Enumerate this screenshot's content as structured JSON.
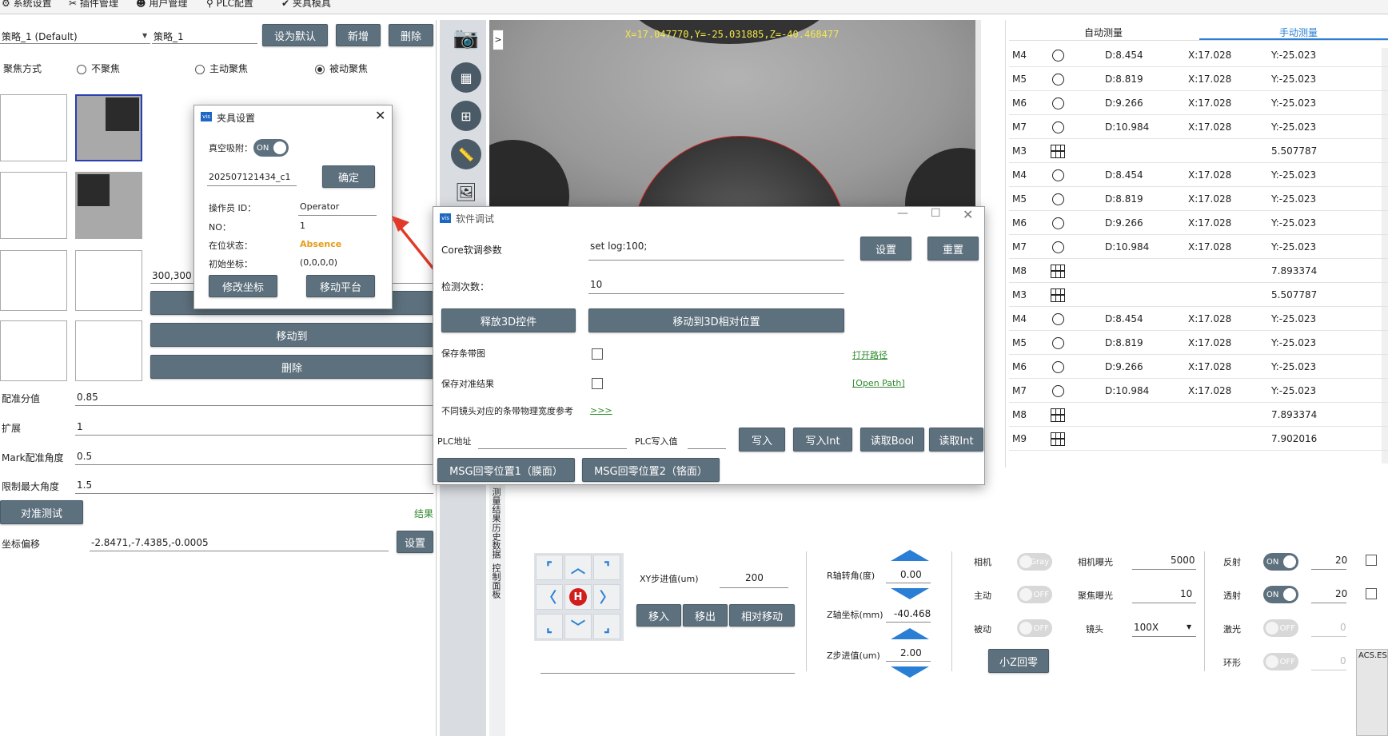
{
  "menu": [
    "系统设置",
    "插件管理",
    "用户管理",
    "PLC配置",
    "夹具模具"
  ],
  "left": {
    "strategy_select": "策略_1 (Default)",
    "strategy_name": "策略_1",
    "btn_set_default": "设为默认",
    "btn_add": "新增",
    "btn_delete": "删除",
    "focus_label": "聚焦方式",
    "focus_opts": [
      "不聚焦",
      "主动聚焦",
      "被动聚焦"
    ],
    "coord_field": "300,300",
    "btn_move_to": "移动到",
    "btn_delete2": "删除",
    "fields": [
      {
        "label": "配准分值",
        "value": "0.85"
      },
      {
        "label": "扩展",
        "value": "1"
      },
      {
        "label": "Mark配准角度",
        "value": "0.5"
      },
      {
        "label": "限制最大角度",
        "value": "1.5"
      }
    ],
    "btn_align_test": "对准测试",
    "result_label": "结果",
    "offset_label": "坐标偏移",
    "offset_value": "-2.8471,-7.4385,-0.0005",
    "btn_offset_set": "设置"
  },
  "camera": {
    "coords": "X=17.047770,Y=-25.031885,Z=-40.468477",
    "expand_btn": ">"
  },
  "fixture_dialog": {
    "title": "夹具设置",
    "vacuum_label": "真空吸附：",
    "vacuum_state": "ON",
    "code": "202507121434_c1",
    "btn_confirm": "确定",
    "operator_label": "操作员 ID：",
    "operator": "Operator",
    "no_label": "NO：",
    "no": "1",
    "status_label": "在位状态：",
    "status": "Absence",
    "init_label": "初始坐标：",
    "init": "(0,0,0,0)",
    "btn_modify": "修改坐标",
    "btn_move_platform": "移动平台"
  },
  "debug_dialog": {
    "title": "软件调试",
    "core_label": "Core软调参数",
    "core_value": "set log:100;",
    "btn_set": "设置",
    "btn_reset": "重置",
    "count_label": "检测次数：",
    "count_value": "10",
    "btn_release3d": "释放3D控件",
    "btn_move3d": "移动到3D相对位置",
    "save_strip_label": "保存条带图",
    "open_path_cn": "打开路径",
    "save_align_label": "保存对准结果",
    "open_path_en": "[Open Path]",
    "lens_ref_label": "不同镜头对应的条带物理宽度参考",
    "lens_ref_link": ">>>",
    "plc_addr_label": "PLC地址",
    "plc_write_label": "PLC写入值",
    "btn_write": "写入",
    "btn_write_int": "写入Int",
    "btn_read_bool": "读取Bool",
    "btn_read_int": "读取Int",
    "btn_msg1": "MSG回零位置1（膜面）",
    "btn_msg2": "MSG回零位置2（铬面）"
  },
  "measure": {
    "tab_auto": "自动测量",
    "tab_manual": "手动测量",
    "rows": [
      {
        "name": "M4",
        "icon": "circle",
        "d": "D:8.454",
        "x": "X:17.028",
        "y": "Y:-25.023"
      },
      {
        "name": "M5",
        "icon": "circle",
        "d": "D:8.819",
        "x": "X:17.028",
        "y": "Y:-25.023"
      },
      {
        "name": "M6",
        "icon": "circle",
        "d": "D:9.266",
        "x": "X:17.028",
        "y": "Y:-25.023"
      },
      {
        "name": "M7",
        "icon": "circle",
        "d": "D:10.984",
        "x": "X:17.028",
        "y": "Y:-25.023"
      },
      {
        "name": "M3",
        "icon": "grid",
        "d": "",
        "x": "",
        "y": "5.507787"
      },
      {
        "name": "M4",
        "icon": "circle",
        "d": "D:8.454",
        "x": "X:17.028",
        "y": "Y:-25.023"
      },
      {
        "name": "M5",
        "icon": "circle",
        "d": "D:8.819",
        "x": "X:17.028",
        "y": "Y:-25.023"
      },
      {
        "name": "M6",
        "icon": "circle",
        "d": "D:9.266",
        "x": "X:17.028",
        "y": "Y:-25.023"
      },
      {
        "name": "M7",
        "icon": "circle",
        "d": "D:10.984",
        "x": "X:17.028",
        "y": "Y:-25.023"
      },
      {
        "name": "M8",
        "icon": "grid",
        "d": "",
        "x": "",
        "y": "7.893374"
      },
      {
        "name": "M3",
        "icon": "grid",
        "d": "",
        "x": "",
        "y": "5.507787"
      },
      {
        "name": "M4",
        "icon": "circle",
        "d": "D:8.454",
        "x": "X:17.028",
        "y": "Y:-25.023"
      },
      {
        "name": "M5",
        "icon": "circle",
        "d": "D:8.819",
        "x": "X:17.028",
        "y": "Y:-25.023"
      },
      {
        "name": "M6",
        "icon": "circle",
        "d": "D:9.266",
        "x": "X:17.028",
        "y": "Y:-25.023"
      },
      {
        "name": "M7",
        "icon": "circle",
        "d": "D:10.984",
        "x": "X:17.028",
        "y": "Y:-25.023"
      },
      {
        "name": "M8",
        "icon": "grid",
        "d": "",
        "x": "",
        "y": "7.893374"
      },
      {
        "name": "M9",
        "icon": "grid",
        "d": "",
        "x": "",
        "y": "7.902016"
      }
    ]
  },
  "vtabs": [
    "测量结果",
    "历史数据",
    "控制面板"
  ],
  "motion": {
    "xy_step_label": "XY步进值(um)",
    "xy_step": "200",
    "btn_in": "移入",
    "btn_out": "移出",
    "btn_rel": "相对移动",
    "r_label": "R轴转角(度)",
    "r_value": "0.00",
    "z_label": "Z轴坐标(mm)",
    "z_value": "-40.468",
    "zstep_label": "Z步进值(um)",
    "zstep_value": "2.00",
    "home_glyph": "H"
  },
  "camctl": {
    "camera_label": "相机",
    "camera_toggle": "Gray",
    "active_label": "主动",
    "active_toggle": "OFF",
    "passive_label": "被动",
    "passive_toggle": "OFF",
    "exposure_label": "相机曝光",
    "exposure": "5000",
    "focus_exp_label": "聚焦曝光",
    "focus_exp": "10",
    "lens_label": "镜头",
    "lens": "100X",
    "btn_small_z": "小Z回零",
    "reflect_label": "反射",
    "reflect_toggle": "ON",
    "reflect_val": "20",
    "trans_label": "透射",
    "trans_toggle": "ON",
    "trans_val": "20",
    "laser_label": "激光",
    "laser_toggle": "OFF",
    "laser_val": "0",
    "ring_label": "环形",
    "ring_toggle": "OFF",
    "ring_val": "0",
    "acs_text": "ACS.ES"
  }
}
